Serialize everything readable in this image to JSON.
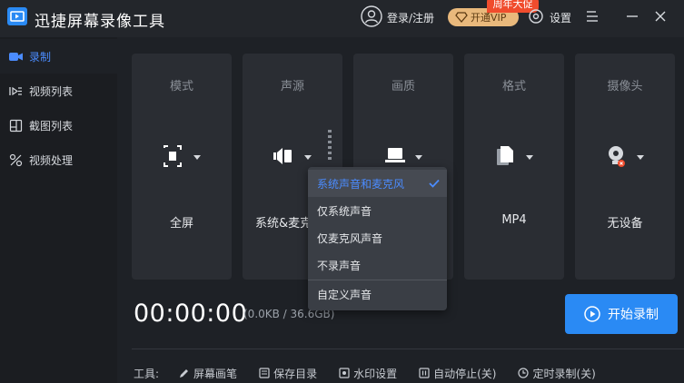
{
  "app": {
    "title": "迅捷屏幕录像工具"
  },
  "header": {
    "login": "登录/注册",
    "vip": "开通VIP",
    "promo": "周年大促",
    "settings": "设置"
  },
  "sidebar": {
    "items": [
      {
        "label": "录制",
        "icon": "camera-icon",
        "active": true
      },
      {
        "label": "视频列表",
        "icon": "video-list-icon",
        "active": false
      },
      {
        "label": "截图列表",
        "icon": "screenshot-list-icon",
        "active": false
      },
      {
        "label": "视频处理",
        "icon": "video-process-icon",
        "active": false
      }
    ]
  },
  "cards": [
    {
      "title": "模式",
      "value": "全屏",
      "icon": "fullscreen-icon"
    },
    {
      "title": "声源",
      "value": "系统&麦克",
      "icon": "speaker-icon"
    },
    {
      "title": "画质",
      "value": "",
      "icon": "laptop-icon"
    },
    {
      "title": "格式",
      "value": "MP4",
      "icon": "file-icon"
    },
    {
      "title": "摄像头",
      "value": "无设备",
      "icon": "webcam-icon"
    }
  ],
  "status": {
    "timer": "00:00:00",
    "storage": "(0.0KB / 36.6GB)"
  },
  "start_button": {
    "label": "开始录制"
  },
  "tools": {
    "label": "工具:",
    "items": [
      {
        "label": "屏幕画笔",
        "icon": "pen-icon"
      },
      {
        "label": "保存目录",
        "icon": "folder-icon"
      },
      {
        "label": "水印设置",
        "icon": "watermark-icon"
      },
      {
        "label": "自动停止(关)",
        "icon": "pause-icon"
      },
      {
        "label": "定时录制(关)",
        "icon": "clock-icon"
      }
    ]
  },
  "dropdown": {
    "options": [
      {
        "label": "系统声音和麦克风",
        "selected": true
      },
      {
        "label": "仅系统声音",
        "selected": false
      },
      {
        "label": "仅麦克风声音",
        "selected": false
      },
      {
        "label": "不录声音",
        "selected": false
      },
      {
        "label": "自定义声音",
        "selected": false
      }
    ]
  },
  "colors": {
    "accent": "#2a8af4",
    "vip": "#e9b97c",
    "promo": "#f04c2d"
  }
}
